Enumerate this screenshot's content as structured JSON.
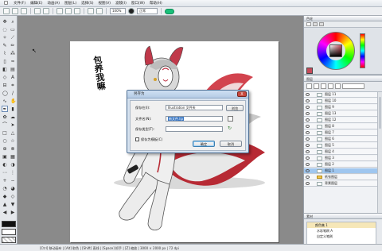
{
  "menubar": {
    "items": [
      "文件(F)",
      "编辑(E)",
      "动画(A)",
      "图层(L)",
      "选择(S)",
      "视图(V)",
      "滤镜(I)",
      "窗口(W)",
      "帮助(H)"
    ],
    "extra_items": [
      "画布(C)",
      "工具(T)",
      "素材(M)",
      "导出(X)"
    ]
  },
  "optbar": {
    "tool_value": "100%",
    "mode_value": "正常"
  },
  "dialog": {
    "title": "另存为",
    "close_label": "X",
    "rows": [
      {
        "label": "保存在(I):",
        "value": "Illustration 文件夹"
      },
      {
        "label": "文件名(N):",
        "value": "新文件.lip"
      },
      {
        "label": "保存类型(T):",
        "value": ""
      }
    ],
    "browse_label": "浏览",
    "checkbox_label": "保存为模板(C)",
    "ok_label": "确定",
    "cancel_label": "取消"
  },
  "canvas_text": "包养我嘛",
  "layers": {
    "panel_title": "图层",
    "rows": [
      {
        "name": "图层 11",
        "type": "layer"
      },
      {
        "name": "图层 10",
        "type": "layer"
      },
      {
        "name": "图层 9",
        "type": "layer"
      },
      {
        "name": "图层 13",
        "type": "layer"
      },
      {
        "name": "图层 12",
        "type": "layer"
      },
      {
        "name": "图层 8",
        "type": "layer"
      },
      {
        "name": "图层 7",
        "type": "layer"
      },
      {
        "name": "图层 6",
        "type": "layer"
      },
      {
        "name": "图层 5",
        "type": "layer"
      },
      {
        "name": "图层 4",
        "type": "layer"
      },
      {
        "name": "图层 3",
        "type": "layer"
      },
      {
        "name": "图层 2",
        "type": "layer"
      },
      {
        "name": "图层 1",
        "type": "selected"
      },
      {
        "name": "纸张图层",
        "type": "folder"
      },
      {
        "name": "背景图层",
        "type": "layer"
      }
    ]
  },
  "bottom_panel": {
    "title": "素材",
    "items": [
      "颜色集 1",
      "水彩笔刷 A",
      "自定义笔刷"
    ]
  },
  "color_panel": {
    "title": "色轮",
    "main_color": "#c74a5a",
    "sub_color": "#ffffff"
  },
  "statusbar": {
    "text": "[Ctrl] 移动画布 | [Alt] 取色 | [Shift] 直线 | [Space] 抓手 | [Z] 缩放 | 3000 × 2000 px | 72 dpi"
  }
}
